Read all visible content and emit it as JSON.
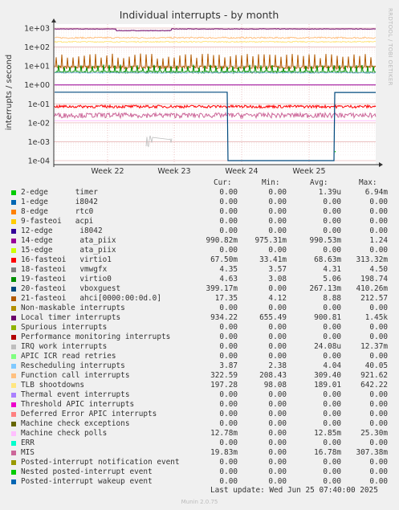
{
  "chart_data": {
    "type": "line",
    "title": "Individual interrupts - by month",
    "ylabel": "interrupts / second",
    "yscale": "log",
    "ylim": [
      0.0001,
      1000
    ],
    "yticks": [
      "1e-04",
      "1e-03",
      "1e-02",
      "1e-01",
      "1e+00",
      "1e+01",
      "1e+02",
      "1e+03"
    ],
    "xticks": [
      "Week 22",
      "Week 23",
      "Week 24",
      "Week 25"
    ],
    "series": [
      {
        "name": "2-edge      timer",
        "color": "#00cc00",
        "cur": "0.00",
        "min": "0.00",
        "avg": "1.39u",
        "max": "6.94m"
      },
      {
        "name": "1-edge      i8042",
        "color": "#0066b3",
        "cur": "0.00",
        "min": "0.00",
        "avg": "0.00",
        "max": "0.00"
      },
      {
        "name": "8-edge      rtc0",
        "color": "#ff8000",
        "cur": "0.00",
        "min": "0.00",
        "avg": "0.00",
        "max": "0.00"
      },
      {
        "name": "9-fasteoi   acpi",
        "color": "#ffcc00",
        "cur": "0.00",
        "min": "0.00",
        "avg": "0.00",
        "max": "0.00"
      },
      {
        "name": "12-edge      i8042",
        "color": "#330099",
        "cur": "0.00",
        "min": "0.00",
        "avg": "0.00",
        "max": "0.00"
      },
      {
        "name": "14-edge      ata_piix",
        "color": "#990099",
        "cur": "990.82m",
        "min": "975.31m",
        "avg": "990.53m",
        "max": "1.24"
      },
      {
        "name": "15-edge      ata_piix",
        "color": "#ccff00",
        "cur": "0.00",
        "min": "0.00",
        "avg": "0.00",
        "max": "0.00"
      },
      {
        "name": "16-fasteoi   virtio1",
        "color": "#ff0000",
        "cur": "67.50m",
        "min": "33.41m",
        "avg": "68.63m",
        "max": "313.32m"
      },
      {
        "name": "18-fasteoi   vmwgfx",
        "color": "#808080",
        "cur": "4.35",
        "min": "3.57",
        "avg": "4.31",
        "max": "4.50"
      },
      {
        "name": "19-fasteoi   virtio0",
        "color": "#008f00",
        "cur": "4.63",
        "min": "3.08",
        "avg": "5.06",
        "max": "198.74"
      },
      {
        "name": "20-fasteoi   vboxguest",
        "color": "#00487d",
        "cur": "399.17m",
        "min": "0.00",
        "avg": "267.13m",
        "max": "410.26m"
      },
      {
        "name": "21-fasteoi   ahci[0000:00:0d.0]",
        "color": "#b35a00",
        "cur": "17.35",
        "min": "4.12",
        "avg": "8.88",
        "max": "212.57"
      },
      {
        "name": "Non-maskable interrupts",
        "color": "#b38f00",
        "cur": "0.00",
        "min": "0.00",
        "avg": "0.00",
        "max": "0.00"
      },
      {
        "name": "Local timer interrupts",
        "color": "#6b006b",
        "cur": "934.22",
        "min": "655.49",
        "avg": "900.81",
        "max": "1.45k"
      },
      {
        "name": "Spurious interrupts",
        "color": "#8fb300",
        "cur": "0.00",
        "min": "0.00",
        "avg": "0.00",
        "max": "0.00"
      },
      {
        "name": "Performance monitoring interrupts",
        "color": "#b30000",
        "cur": "0.00",
        "min": "0.00",
        "avg": "0.00",
        "max": "0.00"
      },
      {
        "name": "IRQ work interrupts",
        "color": "#bebebe",
        "cur": "0.00",
        "min": "0.00",
        "avg": "24.08u",
        "max": "12.37m"
      },
      {
        "name": "APIC ICR read retries",
        "color": "#80ff80",
        "cur": "0.00",
        "min": "0.00",
        "avg": "0.00",
        "max": "0.00"
      },
      {
        "name": "Rescheduling interrupts",
        "color": "#80c9ff",
        "cur": "3.87",
        "min": "2.38",
        "avg": "4.04",
        "max": "40.05"
      },
      {
        "name": "Function call interrupts",
        "color": "#ffc080",
        "cur": "322.59",
        "min": "208.43",
        "avg": "309.40",
        "max": "921.62"
      },
      {
        "name": "TLB shootdowns",
        "color": "#ffe680",
        "cur": "197.28",
        "min": "98.08",
        "avg": "189.01",
        "max": "642.22"
      },
      {
        "name": "Thermal event interrupts",
        "color": "#aa80ff",
        "cur": "0.00",
        "min": "0.00",
        "avg": "0.00",
        "max": "0.00"
      },
      {
        "name": "Threshold APIC interrupts",
        "color": "#ee00cc",
        "cur": "0.00",
        "min": "0.00",
        "avg": "0.00",
        "max": "0.00"
      },
      {
        "name": "Deferred Error APIC interrupts",
        "color": "#ff8080",
        "cur": "0.00",
        "min": "0.00",
        "avg": "0.00",
        "max": "0.00"
      },
      {
        "name": "Machine check exceptions",
        "color": "#666600",
        "cur": "0.00",
        "min": "0.00",
        "avg": "0.00",
        "max": "0.00"
      },
      {
        "name": "Machine check polls",
        "color": "#ffbfff",
        "cur": "12.78m",
        "min": "0.00",
        "avg": "12.85m",
        "max": "25.30m"
      },
      {
        "name": "ERR",
        "color": "#00ffcc",
        "cur": "0.00",
        "min": "0.00",
        "avg": "0.00",
        "max": "0.00"
      },
      {
        "name": "MIS",
        "color": "#cc6699",
        "cur": "19.83m",
        "min": "0.00",
        "avg": "16.78m",
        "max": "307.38m"
      },
      {
        "name": "Posted-interrupt notification event",
        "color": "#999900",
        "cur": "0.00",
        "min": "0.00",
        "avg": "0.00",
        "max": "0.00"
      },
      {
        "name": "Nested posted-interrupt event",
        "color": "#00cc00",
        "cur": "0.00",
        "min": "0.00",
        "avg": "0.00",
        "max": "0.00"
      },
      {
        "name": "Posted-interrupt wakeup event",
        "color": "#0066b3",
        "cur": "0.00",
        "min": "0.00",
        "avg": "0.00",
        "max": "0.00"
      }
    ]
  },
  "legend_headers": {
    "cur": "Cur:",
    "min": "Min:",
    "avg": "Avg:",
    "max": "Max:"
  },
  "last_update": "Last update: Wed Jun 25 07:40:00 2025",
  "footer": "Munin 2.0.75",
  "side_label": "RRDTOOL / TOBI OETIKER"
}
